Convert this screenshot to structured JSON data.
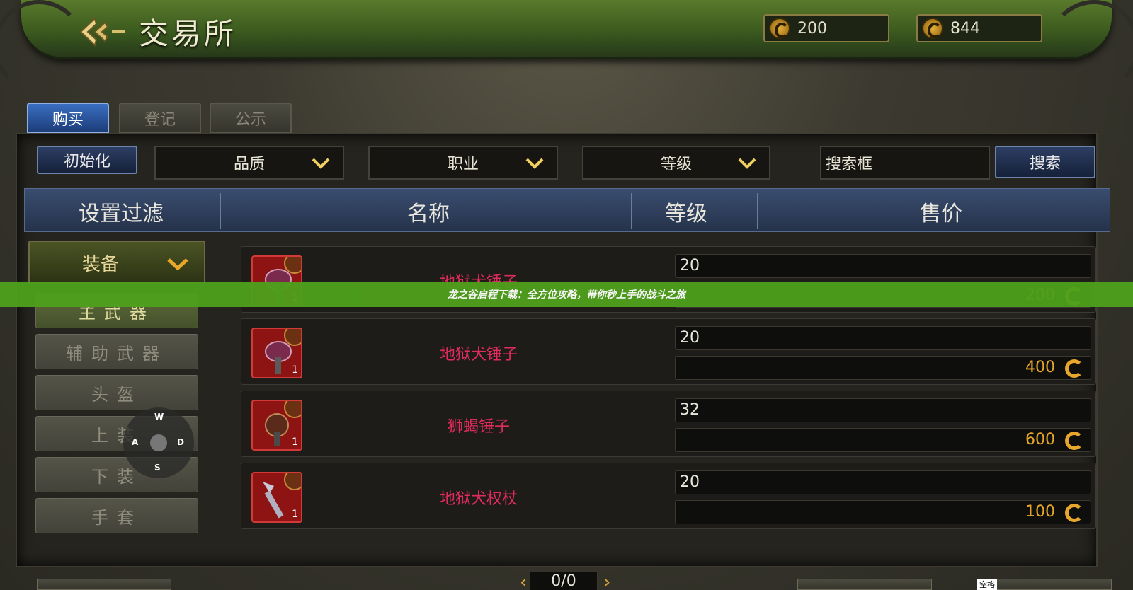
{
  "header": {
    "title": "交易所",
    "currency_1": "200",
    "currency_2": "844"
  },
  "tabs": [
    {
      "label": "购买"
    },
    {
      "label": "登记"
    },
    {
      "label": "公示"
    }
  ],
  "filters": {
    "reset_label": "初始化",
    "quality": "品质",
    "class": "职业",
    "level": "等级",
    "search_placeholder": "搜索框",
    "search_button": "搜索"
  },
  "columns": {
    "filter": "设置过滤",
    "name": "名称",
    "level": "等级",
    "price": "售价"
  },
  "sidebar": {
    "category": "装备",
    "items": [
      {
        "label": "主武器"
      },
      {
        "label": "辅助武器"
      },
      {
        "label": "头盔"
      },
      {
        "label": "上装"
      },
      {
        "label": "下装"
      },
      {
        "label": "手套"
      }
    ]
  },
  "items": [
    {
      "name": "地狱犬锤子",
      "level": "20",
      "price": "200",
      "qty": "1"
    },
    {
      "name": "地狱犬锤子",
      "level": "20",
      "price": "400",
      "qty": "1"
    },
    {
      "name": "狮蝎锤子",
      "level": "32",
      "price": "600",
      "qty": "1"
    },
    {
      "name": "地狱犬权杖",
      "level": "20",
      "price": "100",
      "qty": "1"
    }
  ],
  "banner": "龙之谷启程下载：全方位攻略，带你秒上手的战斗之旅",
  "wasd": {
    "up": "W",
    "left": "A",
    "right": "D",
    "down": "S"
  },
  "pager": "0/0",
  "space_label": "空格"
}
